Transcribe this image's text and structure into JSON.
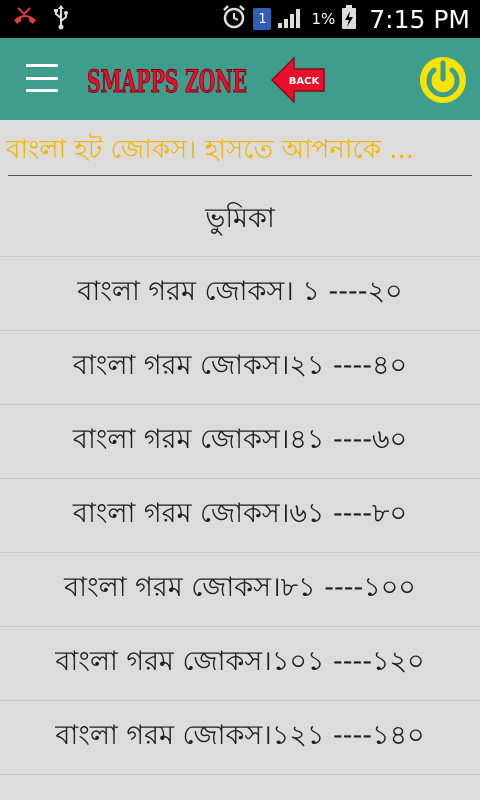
{
  "status_bar": {
    "left_icons": [
      "missed-call-icon",
      "usb-icon"
    ],
    "alarm_icon": "alarm-icon",
    "notification_badge": "1",
    "signal_icon": "signal-icon",
    "battery_percent": "1%",
    "battery_icon": "battery-charging-icon",
    "time": "7:15 PM"
  },
  "app_bar": {
    "background_color": "#3e9d8d",
    "menu_icon": "hamburger-menu-icon",
    "logo_text": "SMAPPS ZONE",
    "back_label": "BACK",
    "power_icon": "power-icon"
  },
  "marquee": {
    "text": "বাংলা হট জোকস। হাসতে আপনাকে ...",
    "color": "#f7b500"
  },
  "list": {
    "items": [
      "ভুমিকা",
      "বাংলা গরম জোকস। ১ ----২০",
      "বাংলা গরম জোকস।২১ ----৪০",
      "বাংলা গরম জোকস।৪১ ----৬০",
      "বাংলা গরম জোকস।৬১ ----৮০",
      "বাংলা গরম জোকস।৮১ ----১০০",
      "বাংলা গরম জোকস।১০১ ----১২০",
      "বাংলা গরম জোকস।১২১ ----১৪০"
    ]
  }
}
